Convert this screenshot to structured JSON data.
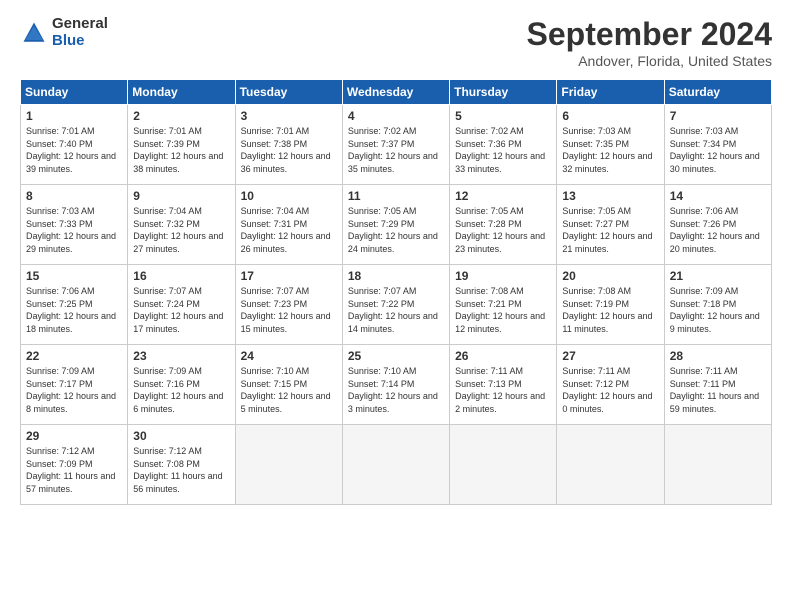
{
  "header": {
    "logo_general": "General",
    "logo_blue": "Blue",
    "month_title": "September 2024",
    "location": "Andover, Florida, United States"
  },
  "weekdays": [
    "Sunday",
    "Monday",
    "Tuesday",
    "Wednesday",
    "Thursday",
    "Friday",
    "Saturday"
  ],
  "weeks": [
    [
      {
        "day": "1",
        "sunrise": "7:01 AM",
        "sunset": "7:40 PM",
        "daylight": "12 hours and 39 minutes."
      },
      {
        "day": "2",
        "sunrise": "7:01 AM",
        "sunset": "7:39 PM",
        "daylight": "12 hours and 38 minutes."
      },
      {
        "day": "3",
        "sunrise": "7:01 AM",
        "sunset": "7:38 PM",
        "daylight": "12 hours and 36 minutes."
      },
      {
        "day": "4",
        "sunrise": "7:02 AM",
        "sunset": "7:37 PM",
        "daylight": "12 hours and 35 minutes."
      },
      {
        "day": "5",
        "sunrise": "7:02 AM",
        "sunset": "7:36 PM",
        "daylight": "12 hours and 33 minutes."
      },
      {
        "day": "6",
        "sunrise": "7:03 AM",
        "sunset": "7:35 PM",
        "daylight": "12 hours and 32 minutes."
      },
      {
        "day": "7",
        "sunrise": "7:03 AM",
        "sunset": "7:34 PM",
        "daylight": "12 hours and 30 minutes."
      }
    ],
    [
      {
        "day": "8",
        "sunrise": "7:03 AM",
        "sunset": "7:33 PM",
        "daylight": "12 hours and 29 minutes."
      },
      {
        "day": "9",
        "sunrise": "7:04 AM",
        "sunset": "7:32 PM",
        "daylight": "12 hours and 27 minutes."
      },
      {
        "day": "10",
        "sunrise": "7:04 AM",
        "sunset": "7:31 PM",
        "daylight": "12 hours and 26 minutes."
      },
      {
        "day": "11",
        "sunrise": "7:05 AM",
        "sunset": "7:29 PM",
        "daylight": "12 hours and 24 minutes."
      },
      {
        "day": "12",
        "sunrise": "7:05 AM",
        "sunset": "7:28 PM",
        "daylight": "12 hours and 23 minutes."
      },
      {
        "day": "13",
        "sunrise": "7:05 AM",
        "sunset": "7:27 PM",
        "daylight": "12 hours and 21 minutes."
      },
      {
        "day": "14",
        "sunrise": "7:06 AM",
        "sunset": "7:26 PM",
        "daylight": "12 hours and 20 minutes."
      }
    ],
    [
      {
        "day": "15",
        "sunrise": "7:06 AM",
        "sunset": "7:25 PM",
        "daylight": "12 hours and 18 minutes."
      },
      {
        "day": "16",
        "sunrise": "7:07 AM",
        "sunset": "7:24 PM",
        "daylight": "12 hours and 17 minutes."
      },
      {
        "day": "17",
        "sunrise": "7:07 AM",
        "sunset": "7:23 PM",
        "daylight": "12 hours and 15 minutes."
      },
      {
        "day": "18",
        "sunrise": "7:07 AM",
        "sunset": "7:22 PM",
        "daylight": "12 hours and 14 minutes."
      },
      {
        "day": "19",
        "sunrise": "7:08 AM",
        "sunset": "7:21 PM",
        "daylight": "12 hours and 12 minutes."
      },
      {
        "day": "20",
        "sunrise": "7:08 AM",
        "sunset": "7:19 PM",
        "daylight": "12 hours and 11 minutes."
      },
      {
        "day": "21",
        "sunrise": "7:09 AM",
        "sunset": "7:18 PM",
        "daylight": "12 hours and 9 minutes."
      }
    ],
    [
      {
        "day": "22",
        "sunrise": "7:09 AM",
        "sunset": "7:17 PM",
        "daylight": "12 hours and 8 minutes."
      },
      {
        "day": "23",
        "sunrise": "7:09 AM",
        "sunset": "7:16 PM",
        "daylight": "12 hours and 6 minutes."
      },
      {
        "day": "24",
        "sunrise": "7:10 AM",
        "sunset": "7:15 PM",
        "daylight": "12 hours and 5 minutes."
      },
      {
        "day": "25",
        "sunrise": "7:10 AM",
        "sunset": "7:14 PM",
        "daylight": "12 hours and 3 minutes."
      },
      {
        "day": "26",
        "sunrise": "7:11 AM",
        "sunset": "7:13 PM",
        "daylight": "12 hours and 2 minutes."
      },
      {
        "day": "27",
        "sunrise": "7:11 AM",
        "sunset": "7:12 PM",
        "daylight": "12 hours and 0 minutes."
      },
      {
        "day": "28",
        "sunrise": "7:11 AM",
        "sunset": "7:11 PM",
        "daylight": "11 hours and 59 minutes."
      }
    ],
    [
      {
        "day": "29",
        "sunrise": "7:12 AM",
        "sunset": "7:09 PM",
        "daylight": "11 hours and 57 minutes."
      },
      {
        "day": "30",
        "sunrise": "7:12 AM",
        "sunset": "7:08 PM",
        "daylight": "11 hours and 56 minutes."
      },
      {
        "day": "",
        "sunrise": "",
        "sunset": "",
        "daylight": ""
      },
      {
        "day": "",
        "sunrise": "",
        "sunset": "",
        "daylight": ""
      },
      {
        "day": "",
        "sunrise": "",
        "sunset": "",
        "daylight": ""
      },
      {
        "day": "",
        "sunrise": "",
        "sunset": "",
        "daylight": ""
      },
      {
        "day": "",
        "sunrise": "",
        "sunset": "",
        "daylight": ""
      }
    ]
  ]
}
